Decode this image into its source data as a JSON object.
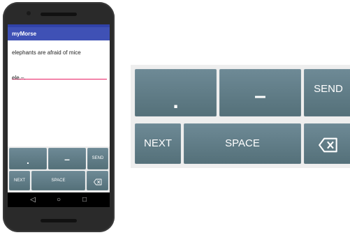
{
  "app": {
    "title": "myMorse"
  },
  "message": {
    "received_text": "elephants are afraid of mice",
    "input_value": "ele.–."
  },
  "keyboard_small": {
    "dot": ".",
    "dash": "–",
    "send": "SEND",
    "next": "NEXT",
    "space": "SPACE",
    "backspace_icon": "backspace-icon"
  },
  "keyboard_large": {
    "dot": ".",
    "dash": "–",
    "send": "SEND",
    "next": "NEXT",
    "space": "SPACE",
    "backspace_icon": "backspace-icon"
  },
  "navbar": {
    "back": "◁",
    "home": "○",
    "recents": "□"
  },
  "colors": {
    "appbar": "#3f51b5",
    "key": "#5c7782",
    "input_underline": "#e91e63"
  }
}
